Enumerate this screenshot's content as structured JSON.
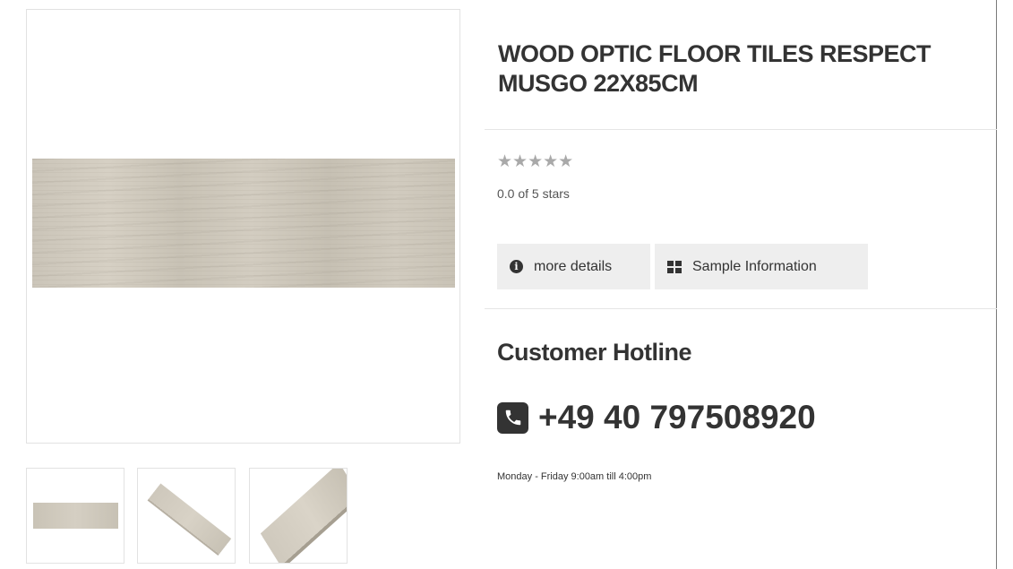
{
  "product": {
    "title": "WOOD OPTIC FLOOR TILES RESPECT MUSGO 22X85CM",
    "rating": {
      "stars": "★★★★★",
      "value": 0.0,
      "max": 5,
      "text": "0.0 of 5 stars"
    }
  },
  "gallery": {
    "main_image": "wood-plank-tile",
    "thumbnails": [
      "wood-plank-flat",
      "wood-plank-diagonal",
      "wood-plank-perspective"
    ]
  },
  "actions": {
    "details_label": "more details",
    "details_icon": "info-icon",
    "sample_label": "Sample Information",
    "sample_icon": "grid-icon"
  },
  "hotline": {
    "heading": "Customer Hotline",
    "phone_icon": "phone-icon",
    "phone": "+49 40 797508920",
    "hours": "Monday - Friday 9:00am till 4:00pm"
  },
  "colors": {
    "text": "#333333",
    "button_bg": "#eeeeee",
    "star_empty": "#a9a9a9",
    "border": "#e2e2e2"
  }
}
